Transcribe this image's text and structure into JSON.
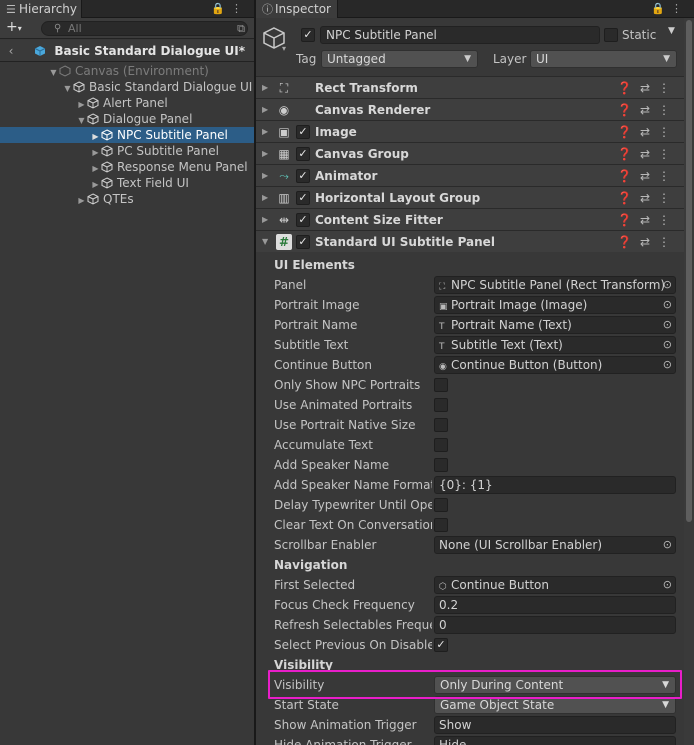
{
  "hierarchy": {
    "tab": "Hierarchy",
    "add_label": "+",
    "search_placeholder": "All",
    "scene": "Basic Standard Dialogue UI*",
    "items": [
      {
        "label": "Canvas (Environment)"
      },
      {
        "label": "Basic Standard Dialogue UI"
      },
      {
        "label": "Alert Panel"
      },
      {
        "label": "Dialogue Panel"
      },
      {
        "label": "NPC Subtitle Panel"
      },
      {
        "label": "PC Subtitle Panel"
      },
      {
        "label": "Response Menu Panel"
      },
      {
        "label": "Text Field UI"
      },
      {
        "label": "QTEs"
      }
    ]
  },
  "inspector": {
    "tab": "Inspector",
    "object_name": "NPC Subtitle Panel",
    "static_label": "Static",
    "tag_label": "Tag",
    "tag_value": "Untagged",
    "layer_label": "Layer",
    "layer_value": "UI",
    "components": [
      {
        "name": "Rect Transform",
        "icon": "rect-transform-icon"
      },
      {
        "name": "Canvas Renderer",
        "icon": "eye-icon"
      },
      {
        "name": "Image",
        "icon": "image-icon"
      },
      {
        "name": "Canvas Group",
        "icon": "grid-icon"
      },
      {
        "name": "Animator",
        "icon": "animator-icon"
      },
      {
        "name": "Horizontal Layout Group",
        "icon": "columns-icon"
      },
      {
        "name": "Content Size Fitter",
        "icon": "fitter-icon"
      },
      {
        "name": "Standard UI Subtitle Panel",
        "icon": "script-icon"
      }
    ],
    "props": [
      {
        "label": "UI Elements",
        "kind": "header"
      },
      {
        "label": "Panel",
        "value": "NPC Subtitle Panel (Rect Transform)",
        "icon": "rect-transform-icon"
      },
      {
        "label": "Portrait Image",
        "value": "Portrait Image (Image)",
        "icon": "image-icon"
      },
      {
        "label": "Portrait Name",
        "value": "Portrait Name (Text)",
        "icon": "text-icon"
      },
      {
        "label": "Subtitle Text",
        "value": "Subtitle Text (Text)",
        "icon": "text-icon"
      },
      {
        "label": "Continue Button",
        "value": "Continue Button (Button)",
        "icon": "button-icon"
      },
      {
        "label": "Only Show NPC Portraits",
        "kind": "check",
        "checked": false
      },
      {
        "label": "Use Animated Portraits",
        "kind": "check",
        "checked": false
      },
      {
        "label": "Use Portrait Native Size",
        "kind": "check",
        "checked": false
      },
      {
        "label": "Accumulate Text",
        "kind": "check",
        "checked": false
      },
      {
        "label": "Add Speaker Name",
        "kind": "check",
        "checked": false
      },
      {
        "label": "Add Speaker Name Format",
        "kind": "text",
        "value": "{0}: {1}"
      },
      {
        "label": "Delay Typewriter Until Oper",
        "kind": "check",
        "checked": false
      },
      {
        "label": "Clear Text On Conversation",
        "kind": "check",
        "checked": false
      },
      {
        "label": "Scrollbar Enabler",
        "value": "None (UI Scrollbar Enabler)"
      },
      {
        "label": "Navigation",
        "kind": "header"
      },
      {
        "label": "First Selected",
        "value": "Continue Button",
        "icon": "cube-icon"
      },
      {
        "label": "Focus Check Frequency",
        "kind": "text",
        "value": "0.2"
      },
      {
        "label": "Refresh Selectables Frequer",
        "kind": "text",
        "value": "0"
      },
      {
        "label": "Select Previous On Disable",
        "kind": "check",
        "checked": true
      },
      {
        "label": "Visibility",
        "kind": "header"
      },
      {
        "label": "Visibility",
        "kind": "drop",
        "value": "Only During Content"
      },
      {
        "label": "Start State",
        "kind": "drop",
        "value": "Game Object State"
      },
      {
        "label": "Show Animation Trigger",
        "kind": "text",
        "value": "Show"
      },
      {
        "label": "Hide Animation Trigger",
        "kind": "text",
        "value": "Hide"
      }
    ]
  },
  "colors": {
    "selection": "#2c5d87",
    "highlight": "#e81ec9",
    "background": "#383838"
  }
}
